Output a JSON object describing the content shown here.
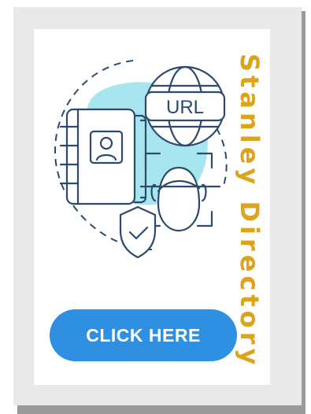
{
  "title": "Stanley Directory",
  "cta_label": "CLICK HERE",
  "illustration": {
    "url_label": "URL",
    "icons": [
      "address-book-icon",
      "globe-icon",
      "face-scan-icon",
      "shield-check-icon"
    ]
  },
  "colors": {
    "accent": "#dca41c",
    "button": "#2f8fe0",
    "line": "#2c4a6e",
    "blob": "#a8e6ef",
    "frame": "#e9e9e9"
  }
}
